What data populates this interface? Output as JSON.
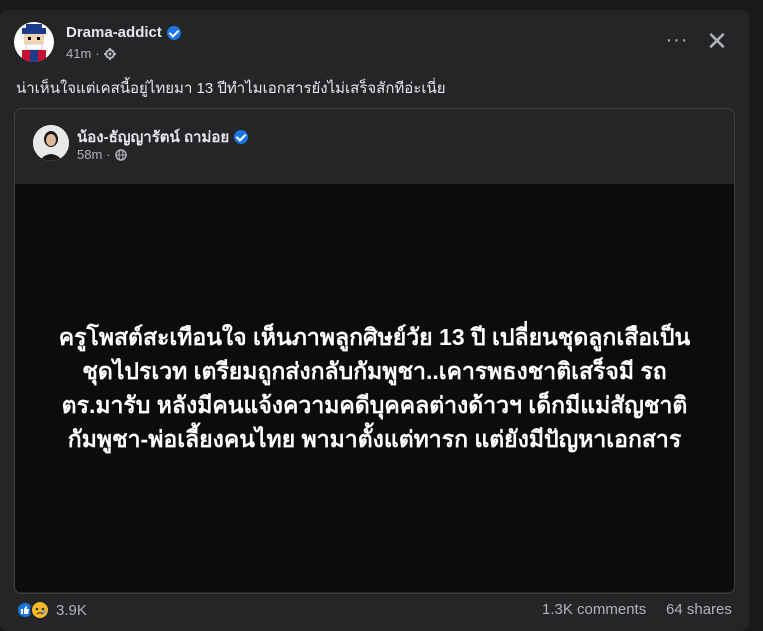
{
  "post": {
    "author": "Drama-addict",
    "time": "41m",
    "text": "น่าเห็นใจแต่เคสนี้อยู่ไทยมา 13 ปีทำไมเอกสารยังไม่เสร็จสักทีอ่ะเนี่ย",
    "more_label": "···",
    "close_label": "✕"
  },
  "shared": {
    "author": "น้อง-ธัญญารัตน์ ถาม่อย",
    "time": "58m",
    "image_text": "ครูโพสต์สะเทือนใจ เห็นภาพลูกศิษย์วัย 13 ปี เปลี่ยนชุดลูกเสือเป็นชุดไปรเวท เตรียมถูกส่งกลับกัมพูชา..เคารพธงชาติเสร็จมี รถ ตร.มารับ หลังมีคนแจ้งความคดีบุคคลต่างด้าวฯ เด็กมีแม่สัญชาติกัมพูชา-พ่อเลี้ยงคนไทย พามาตั้งแต่ทารก แต่ยังมีปัญหาเอกสาร"
  },
  "footer": {
    "reaction_count": "3.9K",
    "comments": "1.3K comments",
    "shares": "64 shares"
  },
  "colors": {
    "background": "#18191a",
    "card": "#242526",
    "verified": "#1b74e4",
    "secondary_text": "#b0b3b8"
  },
  "icons": {
    "verified": "verified-badge-icon",
    "audience": "globe-gear-icon",
    "like": "like-reaction-icon",
    "sad": "sad-reaction-icon"
  }
}
